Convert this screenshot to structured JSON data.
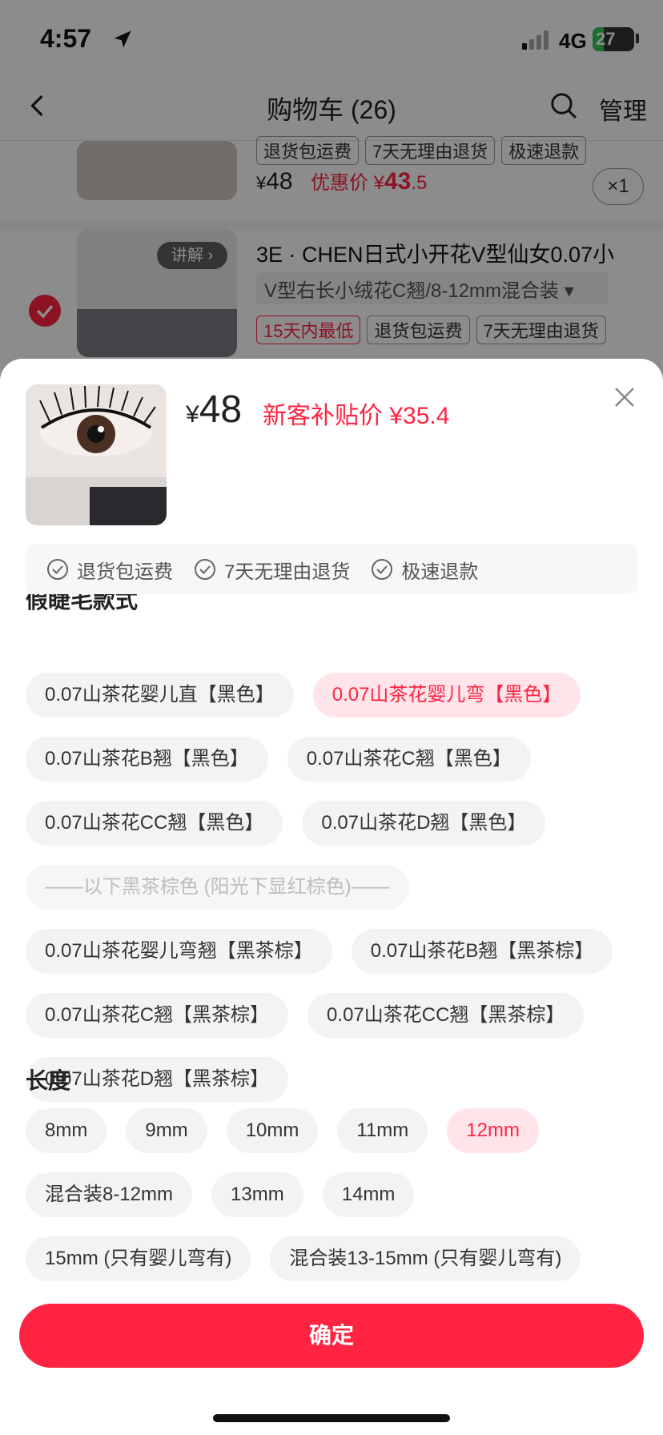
{
  "status_bar": {
    "time": "4:57",
    "network": "4G",
    "battery": "27",
    "battery_level": 0.27
  },
  "header": {
    "title": "购物车 (26)",
    "manage": "管理"
  },
  "cart_item_1": {
    "tags": [
      "退货包运费",
      "7天无理由退货",
      "极速退款"
    ],
    "price_yen": "¥",
    "price": "48",
    "sale_label": "优惠价",
    "sale_yen": "¥",
    "sale_int": "43",
    "sale_dec": ".5",
    "quantity": "×1"
  },
  "cart_item_2": {
    "explain_badge": "讲解 ›",
    "title": "3E · CHEN日式小开花V型仙女0.07小",
    "variant": "V型右长小绒花C翘/8-12mm混合装 ▾",
    "tags": [
      "15天内最低",
      "退货包运费",
      "7天无理由退货"
    ]
  },
  "sku_sheet": {
    "price_yen": "¥",
    "price": "48",
    "promo": "新客补贴价 ¥35.4",
    "guarantees": [
      "退货包运费",
      "7天无理由退货",
      "极速退款"
    ],
    "section_style": "假睫毛款式",
    "style_options": [
      {
        "label": "0.07山茶花婴儿直【黑色】",
        "state": "normal"
      },
      {
        "label": "0.07山茶花婴儿弯【黑色】",
        "state": "selected"
      },
      {
        "label": "0.07山茶花B翘【黑色】",
        "state": "normal"
      },
      {
        "label": "0.07山茶花C翘【黑色】",
        "state": "normal"
      },
      {
        "label": "0.07山茶花CC翘【黑色】",
        "state": "normal"
      },
      {
        "label": "0.07山茶花D翘【黑色】",
        "state": "normal"
      },
      {
        "label": "——以下黑茶棕色 (阳光下显红棕色)——",
        "state": "disabled"
      },
      {
        "label": "0.07山茶花婴儿弯翘【黑茶棕】",
        "state": "normal"
      },
      {
        "label": "0.07山茶花B翘【黑茶棕】",
        "state": "normal"
      },
      {
        "label": "0.07山茶花C翘【黑茶棕】",
        "state": "normal"
      },
      {
        "label": "0.07山茶花CC翘【黑茶棕】",
        "state": "normal"
      },
      {
        "label": "0.07山茶花D翘【黑茶棕】",
        "state": "normal"
      }
    ],
    "section_length": "长度",
    "length_options": [
      {
        "label": "8mm",
        "state": "normal"
      },
      {
        "label": "9mm",
        "state": "normal"
      },
      {
        "label": "10mm",
        "state": "normal"
      },
      {
        "label": "11mm",
        "state": "normal"
      },
      {
        "label": "12mm",
        "state": "selected"
      },
      {
        "label": "混合装8-12mm",
        "state": "normal"
      },
      {
        "label": "13mm",
        "state": "normal"
      },
      {
        "label": "14mm",
        "state": "normal"
      },
      {
        "label": "15mm (只有婴儿弯有)",
        "state": "normal"
      },
      {
        "label": "混合装13-15mm (只有婴儿弯有)",
        "state": "normal"
      }
    ],
    "confirm": "确定"
  },
  "colors": {
    "accent": "#ff2442",
    "selected_chip_bg": "#ffe5ea",
    "chip_bg": "#f3f3f3"
  }
}
